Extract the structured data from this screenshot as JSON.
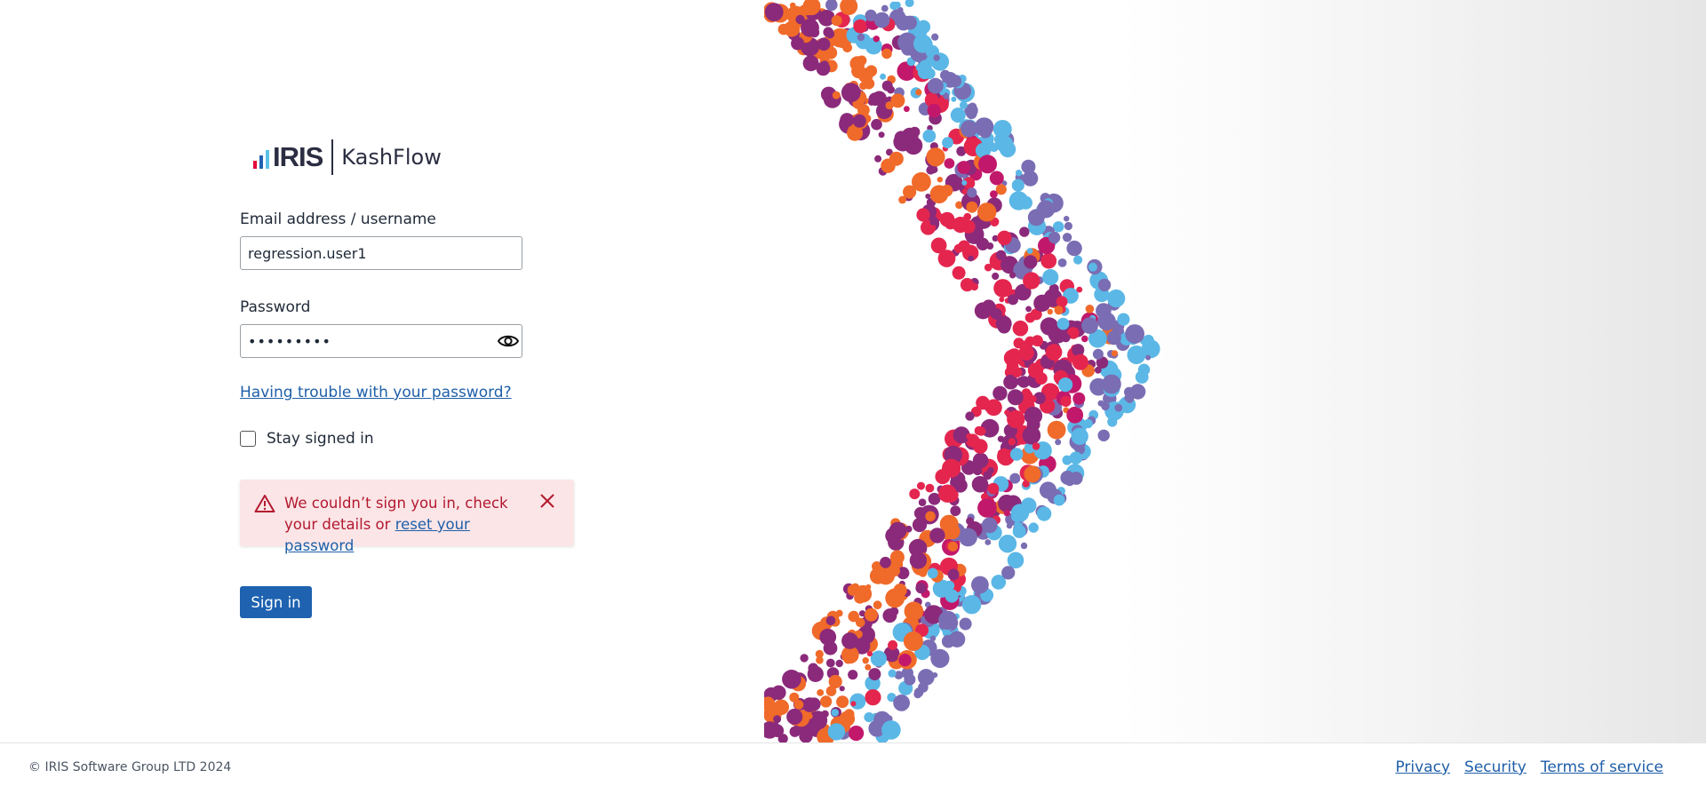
{
  "brand": {
    "logo_wordmark": "IRIS",
    "product_name": "KashFlow",
    "bar_colors": [
      "#e4003b",
      "#1e62b0",
      "#5bc2e7"
    ]
  },
  "form": {
    "email_label": "Email address / username",
    "email_value": "regression.user1",
    "password_label": "Password",
    "password_value": "•••••••••",
    "trouble_link": "Having trouble with your password?",
    "stay_signed_in_label": "Stay signed in",
    "stay_signed_in_checked": false,
    "sign_in_button": "Sign in"
  },
  "alert": {
    "message_prefix": "We couldn’t sign you in, check your details or",
    "reset_link": "reset your password",
    "icon": "warning-triangle-icon",
    "close_icon": "close-icon"
  },
  "footer": {
    "copyright": "© IRIS Software Group LTD 2024",
    "links": [
      "Privacy",
      "Security",
      "Terms of service"
    ]
  },
  "colors": {
    "primary": "#1e62b0",
    "link": "#1f5fa8",
    "error_text": "#b3192f",
    "error_bg": "#fbe5e7"
  }
}
